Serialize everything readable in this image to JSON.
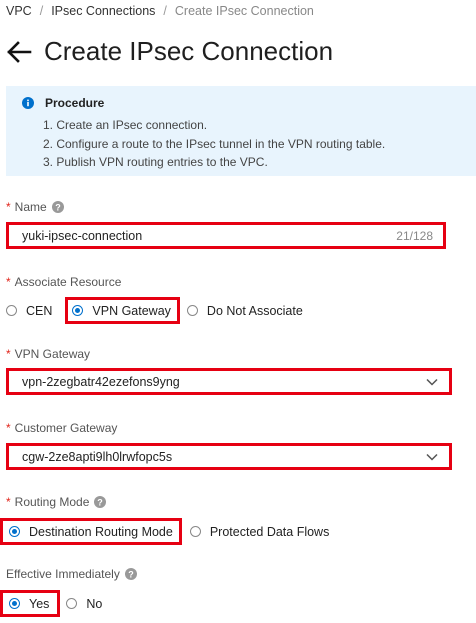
{
  "breadcrumb": {
    "items": [
      "VPC",
      "IPsec Connections",
      "Create IPsec Connection"
    ],
    "separator": "/"
  },
  "header": {
    "title": "Create IPsec Connection",
    "back_icon": "arrow-left-icon"
  },
  "procedure": {
    "title": "Procedure",
    "icon": "info-icon",
    "steps": [
      "1. Create an IPsec connection.",
      "2. Configure a route to the IPsec tunnel in the VPN routing table.",
      "3. Publish VPN routing entries to the VPC."
    ]
  },
  "form": {
    "required_mark": "*",
    "name": {
      "label": "Name",
      "value": "yuki-ipsec-connection",
      "counter": "21/128"
    },
    "associate_resource": {
      "label": "Associate Resource",
      "options": [
        "CEN",
        "VPN Gateway",
        "Do Not Associate"
      ],
      "selected": "VPN Gateway"
    },
    "vpn_gateway": {
      "label": "VPN Gateway",
      "value": "vpn-2zegbatr42ezefons9yng"
    },
    "customer_gateway": {
      "label": "Customer Gateway",
      "value": "cgw-2ze8apti9lh0lrwfopc5s"
    },
    "routing_mode": {
      "label": "Routing Mode",
      "options": [
        "Destination Routing Mode",
        "Protected Data Flows"
      ],
      "selected": "Destination Routing Mode"
    },
    "effective_immediately": {
      "label": "Effective Immediately",
      "options": [
        "Yes",
        "No"
      ],
      "selected": "Yes"
    }
  },
  "colors": {
    "accent": "#0070cc",
    "highlight": "#e60012",
    "required": "#e1251b",
    "notice_bg": "#e8f4fd"
  }
}
